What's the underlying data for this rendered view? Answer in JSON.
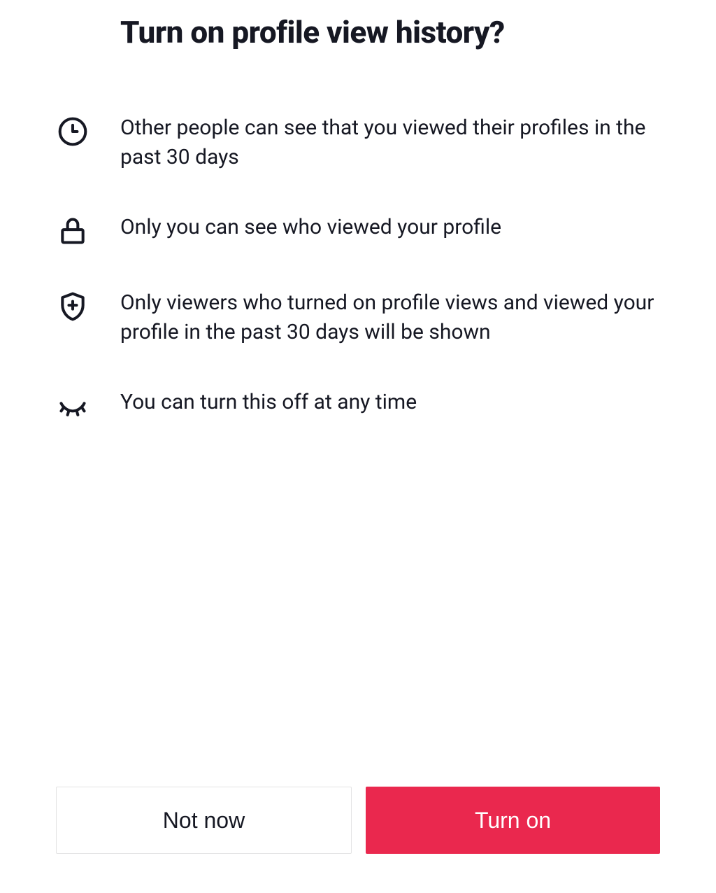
{
  "title": "Turn on profile view history?",
  "items": [
    {
      "text": "Other people can see that you viewed their profiles in the past 30 days"
    },
    {
      "text": "Only you can see who viewed your profile"
    },
    {
      "text": "Only viewers who turned on profile views and viewed your profile in the past 30 days will be shown"
    },
    {
      "text": "You can turn this off at any time"
    }
  ],
  "buttons": {
    "secondary": "Not now",
    "primary": "Turn on"
  }
}
